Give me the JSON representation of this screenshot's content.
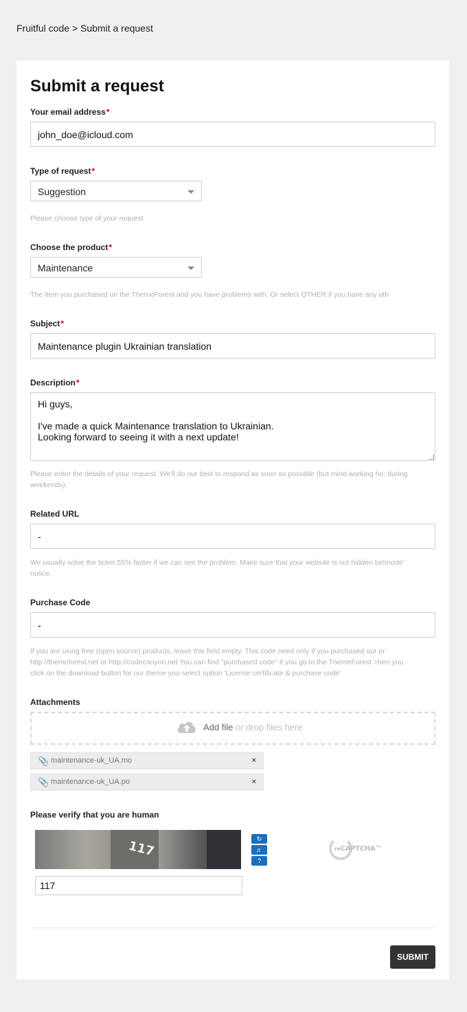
{
  "breadcrumb": {
    "home": "Fruitful code",
    "separator": ">",
    "current": "Submit a request"
  },
  "form": {
    "title": "Submit a request",
    "required_mark": "*",
    "email": {
      "label": "Your email address",
      "value": "john_doe@icloud.com"
    },
    "request_type": {
      "label": "Type of request",
      "value": "Suggestion",
      "hint": "Please choose type of your request"
    },
    "product": {
      "label": "Choose the product",
      "value": "Maintenance",
      "hint": "The item you purchased on the ThemeForest and you have problems with. Or select OTHER if you have any oth"
    },
    "subject": {
      "label": "Subject",
      "value": "Maintenance plugin Ukrainian translation"
    },
    "description": {
      "label": "Description",
      "line1": "Hi guys,",
      "line2": "I've made a quick Maintenance translation to Ukrainian.",
      "line3": "Looking forward to seeing it with a next update!",
      "hint_line1": "Please enter the details of your request. We'll do our best to respond as soon as possible (but mind working ho: during",
      "hint_line2": "weekends)."
    },
    "related_url": {
      "label": "Related URL",
      "value": "-",
      "hint_line1": "We usually solve the ticket 55% faster if we can see the problem. Make sure that your website is not hidden be!mode'",
      "hint_line2": "notice."
    },
    "purchase_code": {
      "label": "Purchase Code",
      "value": "-",
      "hint_line1": "If you are using free (open source) products, leave this field empty. This code need only if you purchased our pr",
      "hint_line2": "http://themeforest.net or http://codecanyon.net You can find \"purchased code\" if you go to the ThemeForest >hen you",
      "hint_line3": "click on the download button for our theme you select option 'License certificate & purchase code'"
    },
    "attachments": {
      "label": "Attachments",
      "add_file": "Add file",
      "drop_text": " or drop files here",
      "files": [
        {
          "name": "maintenance-uk_UA.mo",
          "remove": "×"
        },
        {
          "name": "maintenance-uk_UA.po",
          "remove": "×"
        }
      ]
    },
    "captcha": {
      "label": "Please verify that you are human",
      "image_text": "117",
      "value": "117",
      "brand_re": "re",
      "brand": "CAPTCHA™"
    },
    "submit_label": "SUBMIT"
  },
  "colors": {
    "required": "#cc0000",
    "submit_bg": "#333333",
    "captcha_buttons": "#1a6fbf"
  },
  "icons": [
    "select-caret-icon",
    "cloud-upload-icon",
    "paperclip-icon",
    "remove-icon",
    "refresh-icon",
    "audio-icon",
    "help-icon",
    "recaptcha-logo-icon"
  ]
}
